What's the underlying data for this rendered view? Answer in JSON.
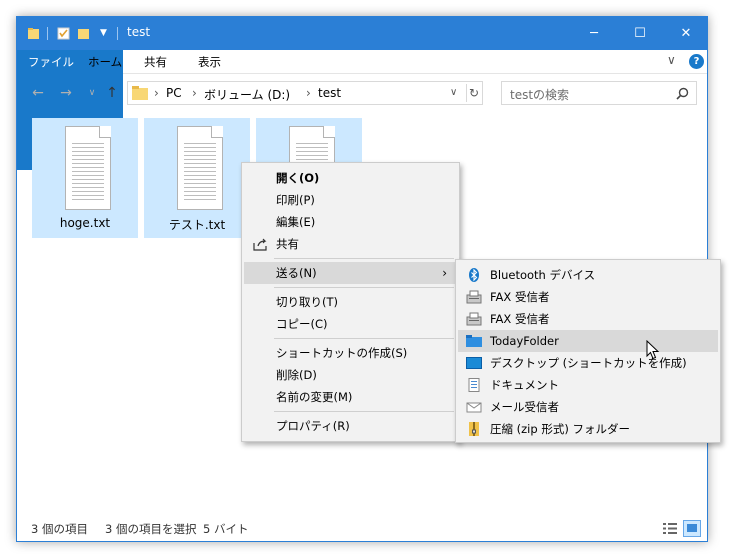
{
  "window": {
    "title": "test",
    "controls": {
      "minimize": "─",
      "maximize": "☐",
      "close": "✕"
    }
  },
  "ribbon": {
    "tabs": [
      "ファイル",
      "ホーム",
      "共有",
      "表示"
    ],
    "expand": "∨",
    "help": "?"
  },
  "address": {
    "crumbs": [
      "PC",
      "ボリューム (D:)",
      "test"
    ],
    "search_placeholder": "testの検索"
  },
  "files": [
    {
      "name": "hoge.txt",
      "selected": true
    },
    {
      "name": "テスト.txt",
      "selected": true
    },
    {
      "name": "",
      "selected": true
    }
  ],
  "status": {
    "count": "3 個の項目",
    "selected": "3 個の項目を選択",
    "size": "5 バイト"
  },
  "context_menu": {
    "items": [
      "開く(O)",
      "印刷(P)",
      "編集(E)",
      "共有",
      "送る(N)",
      "切り取り(T)",
      "コピー(C)",
      "ショートカットの作成(S)",
      "削除(D)",
      "名前の変更(M)",
      "プロパティ(R)"
    ],
    "icons": {
      "share": "share-icon"
    }
  },
  "send_to_menu": {
    "items": [
      {
        "label": "Bluetooth デバイス",
        "icon": "bluetooth-icon"
      },
      {
        "label": "FAX 受信者",
        "icon": "fax-icon"
      },
      {
        "label": "FAX 受信者",
        "icon": "fax-icon"
      },
      {
        "label": "TodayFolder",
        "icon": "folder-icon"
      },
      {
        "label": "デスクトップ (ショートカットを作成)",
        "icon": "desktop-icon"
      },
      {
        "label": "ドキュメント",
        "icon": "documents-icon"
      },
      {
        "label": "メール受信者",
        "icon": "mail-icon"
      },
      {
        "label": "圧縮 (zip 形式) フォルダー",
        "icon": "zip-folder-icon"
      }
    ],
    "highlighted": "TodayFolder"
  },
  "colors": {
    "accent": "#2b7fd6",
    "selection": "#cce8ff",
    "menu_bg": "#f2f2f2",
    "menu_highlight": "#d9d9d9"
  }
}
